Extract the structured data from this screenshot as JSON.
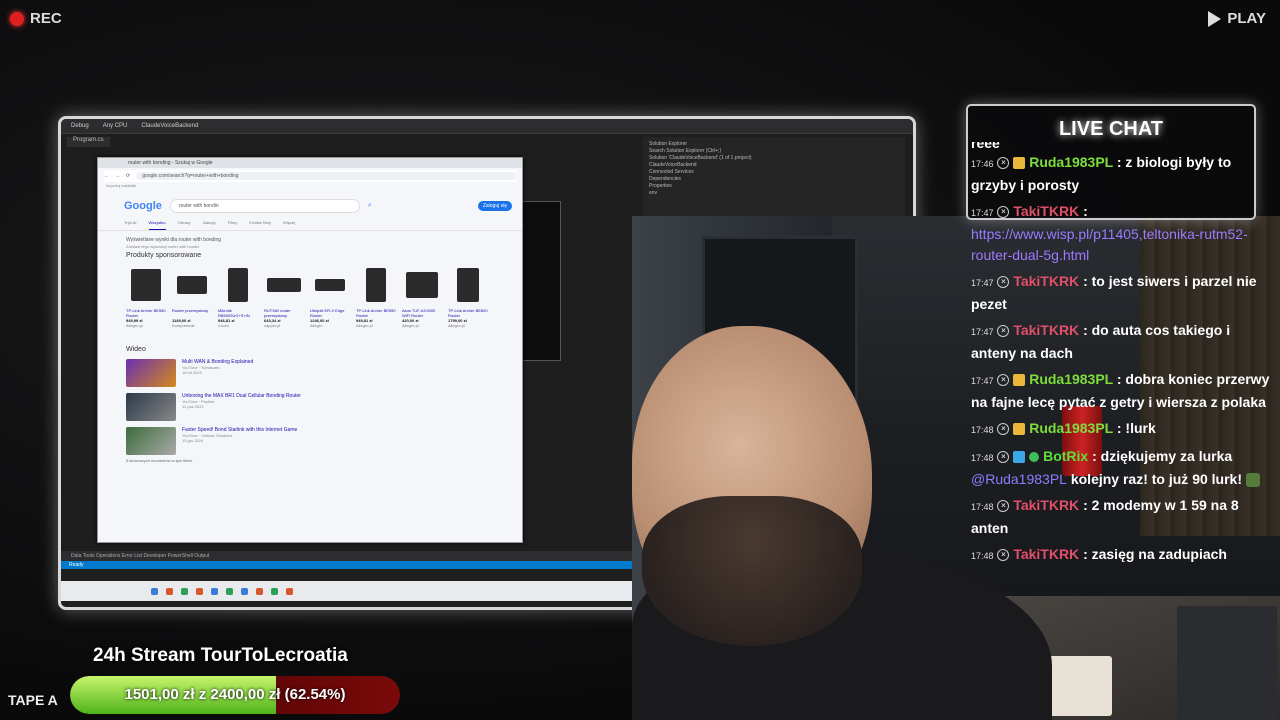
{
  "overlay": {
    "rec_label": "REC",
    "play_label": "PLAY",
    "tape_label": "TAPE A",
    "stream_title": "24h Stream TourToLecroatia",
    "goal": {
      "text": "1501,00 zł z 2400,00 zł (62.54%)",
      "progress_fraction": 0.6254,
      "fill_color": "#6bd12a",
      "track_color": "#5a0505"
    }
  },
  "screen": {
    "vs_menu": [
      "Debug",
      "Any CPU",
      "ClaudeVoiceBackend"
    ],
    "vs_tab": "Program.cs",
    "solution_explorer": [
      "Solution Explorer",
      "Search Solution Explorer (Ctrl+;)",
      "Solution 'ClaudeVoiceBackend' (1 of 1 project)",
      "ClaudeVoiceBackend",
      "Connected Services",
      "Dependencies",
      "Properties",
      "env"
    ],
    "vs_status": "Data Tools Operations   Error List   Developer PowerShell   Output",
    "vs_ready": "Ready",
    "browser": {
      "tab": "router with bonding - Szukaj w Google",
      "url": "google.com/search?q=router+with+bonding",
      "bookmarks": "Importuj zakładki",
      "google_logo": "Google",
      "query": "router with bondin",
      "login": "Zaloguj się",
      "tabs": [
        "Tryb AI",
        "Wszystko",
        "Obrazy",
        "Zakupy",
        "Filmy",
        "Krótkie filmy",
        "Więcej"
      ],
      "note": "Wyświetlane wyniki dla router with bonding",
      "note2": "Zamiast tego wyszukaj router with bondin",
      "sponsored_heading": "Produkty sponsorowane",
      "products": [
        {
          "name": "TP-Link Archer BE550 Router",
          "price": "949,99 zł",
          "shop": "Allegro.pl"
        },
        {
          "name": "Router przemysłowy",
          "price": "1149,00 zł",
          "shop": "Komputronik"
        },
        {
          "name": "Mikrotik RB5009UG+S+IN",
          "price": "946,81 zł",
          "shop": "x-kom"
        },
        {
          "name": "RUT360 router przemysłowy",
          "price": "643,34 zł",
          "shop": "zapper.pl"
        },
        {
          "name": "Ubiquiti ER-X Edge Router",
          "price": "1246,00 zł",
          "shop": "Allegro"
        },
        {
          "name": "TP-Link Archer BE550 Router",
          "price": "949,81 zł",
          "shop": "Allegro.pl"
        },
        {
          "name": "Asus TUF-AX3000 WiFi Router",
          "price": "420,00 zł",
          "shop": "Allegro.pl"
        },
        {
          "name": "TP-Link Archer BE800 Router",
          "price": "1799,00 zł",
          "shop": "Allegro.pl"
        }
      ],
      "video_heading": "Wideo",
      "videos": [
        {
          "title": "Multi WAN & Bonding Explained",
          "source": "YouTube · Tomaszek",
          "date": "16 lut 2023"
        },
        {
          "title": "Unboxing the MAX BR1 Dual Cellular Bonding Router",
          "source": "YouTube · Peplink",
          "date": "11 paź 2022"
        },
        {
          "title": "Faster Speed! Bond Starlink with this Internet Game",
          "source": "YouTube · Cellular Solutions",
          "date": "13 gru 2024"
        }
      ],
      "more_videos": "5 kluczowych momentów w tym filmie"
    }
  },
  "chat": {
    "title": "LIVE CHAT",
    "cut_top": "reee",
    "messages": [
      {
        "time": "17:46",
        "user": "Ruda1983PL",
        "user_class": "u-ruda",
        "badge": "sub",
        "text": ": z biologi były to grzyby i porosty"
      },
      {
        "time": "17:47",
        "user": "TakiTKRK",
        "user_class": "u-taki",
        "badge": "",
        "text": ":",
        "link": "https://www.wisp.pl/p11405,teltonika-rutm52-router-dual-5g.html"
      },
      {
        "time": "17:47",
        "user": "TakiTKRK",
        "user_class": "u-taki",
        "badge": "",
        "text": ": to jest siwers i parzel nie pezet"
      },
      {
        "time": "17:47",
        "user": "TakiTKRK",
        "user_class": "u-taki",
        "badge": "",
        "text": ": do auta cos takiego i anteny na dach"
      },
      {
        "time": "17:47",
        "user": "Ruda1983PL",
        "user_class": "u-ruda",
        "badge": "sub",
        "text": ": dobra koniec przerwy na fajne lecę pytać z getry i wiersza z polaka"
      },
      {
        "time": "17:48",
        "user": "Ruda1983PL",
        "user_class": "u-ruda",
        "badge": "sub",
        "text": ": !lurk"
      },
      {
        "time": "17:48",
        "user": "BotRix",
        "user_class": "u-botrix",
        "badge": "bot",
        "text": ": dziękujemy za lurka",
        "mention": "@Ruda1983PL",
        "tail": "kolejny raz! to już 90 lurk!"
      },
      {
        "time": "17:48",
        "user": "TakiTKRK",
        "user_class": "u-taki",
        "badge": "",
        "text": ": 2 modemy w 1 59 na 8 anten"
      },
      {
        "time": "17:48",
        "user": "TakiTKRK",
        "user_class": "u-taki",
        "badge": "",
        "text": ": zasięg na zadupiach"
      }
    ]
  }
}
